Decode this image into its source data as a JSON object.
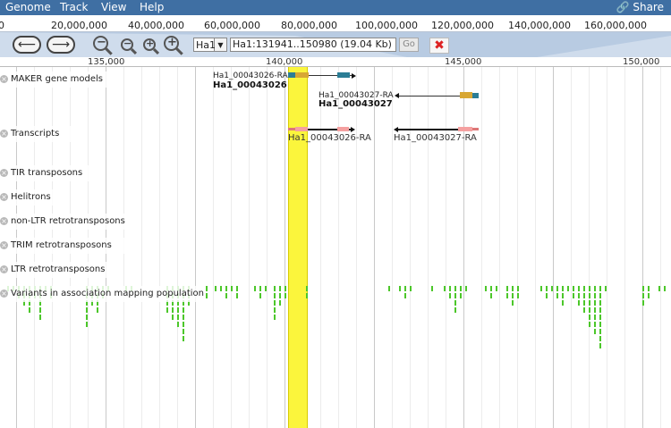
{
  "menu": {
    "items": [
      "Genome",
      "Track",
      "View",
      "Help"
    ],
    "share_label": "Share"
  },
  "overview": {
    "ticks": [
      "0",
      "20,000,000",
      "40,000,000",
      "60,000,000",
      "80,000,000",
      "100,000,000",
      "120,000,000",
      "140,000,000",
      "160,000,000"
    ]
  },
  "toolbar": {
    "refseq": "Ha1",
    "location": "Ha1:131941..150980 (19.04 Kb)",
    "go_label": "Go"
  },
  "ruler": {
    "labels": [
      "135,000",
      "140,000",
      "145,000",
      "150,000"
    ]
  },
  "tracks": [
    "MAKER gene models",
    "Transcripts",
    "TIR transposons",
    "Helitrons",
    "non-LTR retrotransposons",
    "TRIM retrotransposons",
    "LTR retrotransposons",
    "Variants in association mapping population"
  ],
  "features": {
    "gene1_name": "Ha1_00043026-RA",
    "gene1_desc": "Ha1_00043026",
    "gene2_name": "Ha1_00043027-RA",
    "gene2_desc": "Ha1_00043027",
    "tx1_name": "Ha1_00043026-RA",
    "tx2_name": "Ha1_00043027-RA"
  },
  "colors": {
    "menubar": "#3f6fa3",
    "highlight": "#fbf53c",
    "cds": "#d8a733",
    "utr": "#2b7d95",
    "variant": "#4cc72a"
  }
}
